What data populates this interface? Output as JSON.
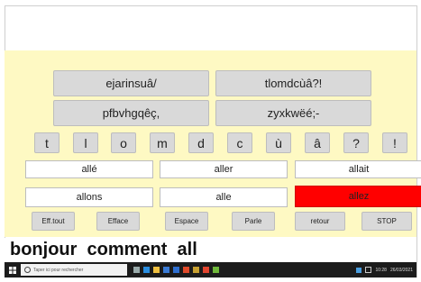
{
  "keyboard": {
    "groups": [
      {
        "label": "ejarinsuâ/"
      },
      {
        "label": "tlomdcùâ?!"
      },
      {
        "label": "pfbvhgqêç,"
      },
      {
        "label": "zyxkwëé;-"
      }
    ],
    "letters": [
      "t",
      "l",
      "o",
      "m",
      "d",
      "c",
      "ù",
      "â",
      "?",
      "!"
    ]
  },
  "suggestions": {
    "words": [
      "allé",
      "aller",
      "allait",
      "allons",
      "alle",
      "allez"
    ],
    "selected_index": 5,
    "selected_color": "#ff0000"
  },
  "controls": [
    "Eff.tout",
    "Efface",
    "Espace",
    "Parle",
    "retour",
    "STOP"
  ],
  "output": {
    "text": "bonjour  comment  all"
  },
  "taskbar": {
    "search_placeholder": "Taper ici pour rechercher",
    "icons": [
      "windows-icon",
      "search-icon",
      "task-view-icon",
      "edge-icon",
      "folder-icon",
      "store-icon",
      "mail-icon",
      "office-icon",
      "app-icon",
      "app-icon",
      "app-icon"
    ],
    "tray": {
      "time": "10:28",
      "date": "26/03/2021"
    }
  },
  "colors": {
    "panel_background": "#fef9c3",
    "button": "#d9d9d9",
    "selected": "#ff0000"
  }
}
